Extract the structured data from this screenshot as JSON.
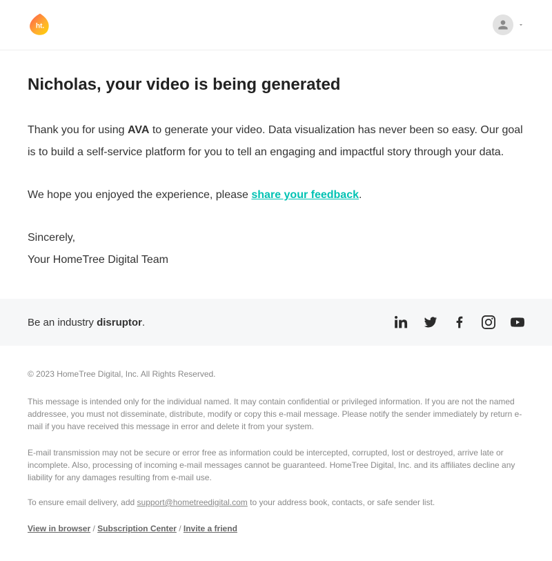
{
  "logo_label": "ht.",
  "main": {
    "title": "Nicholas, your video is being generated",
    "para1_pre": "Thank you for using ",
    "para1_bold": "AVA",
    "para1_post": " to generate your video. Data visualization has never been so easy. Our goal is to build a self-service platform for you to tell an engaging and impactful story through your data.",
    "para2_pre": "We hope you enjoyed the experience, please ",
    "para2_link": "share your feedback",
    "para2_post": ".",
    "signoff1": "Sincerely,",
    "signoff2": "Your HomeTree Digital Team"
  },
  "tagline": {
    "pre": "Be an industry ",
    "bold": "disruptor",
    "post": "."
  },
  "footer": {
    "copyright": "© 2023 HomeTree Digital, Inc. All Rights Reserved.",
    "disclaimer1": "This message is intended only for the individual named. It may contain confidential or privileged information. If you are not the named addressee, you must not disseminate, distribute, modify or copy this e-mail message. Please notify the sender immediately by return e-mail if you have received this message in error and delete it from your system.",
    "disclaimer2": "E-mail transmission may not be secure or error free as information could be intercepted, corrupted, lost or destroyed, arrive late or incomplete. Also, processing of incoming e-mail messages cannot be guaranteed. HomeTree Digital, Inc. and its affiliates decline any liability for any damages resulting from e-mail use.",
    "delivery_pre": "To ensure email delivery, add ",
    "delivery_email": "support@hometreedigital.com",
    "delivery_post": " to your address book, contacts, or safe sender list.",
    "link1": "View in browser",
    "sep": " / ",
    "link2": "Subscription Center",
    "link3": "Invite a friend"
  }
}
